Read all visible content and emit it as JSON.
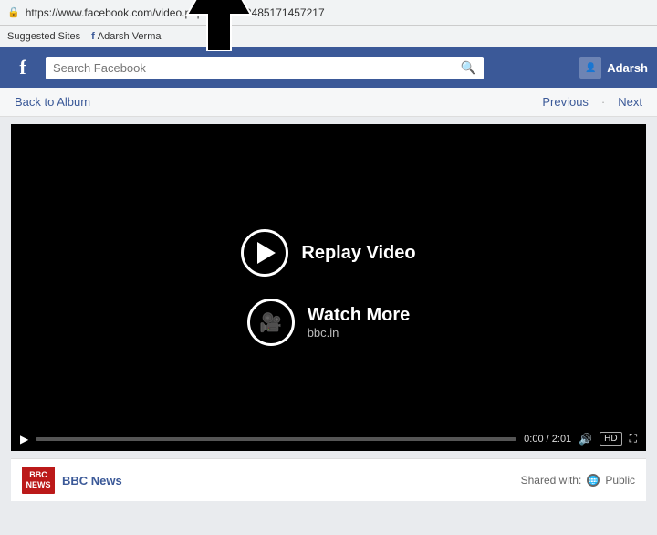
{
  "browser": {
    "url": "https://www.facebook.com/video.php?v=10152485171457217",
    "bookmarks": [
      {
        "label": "Suggested Sites"
      },
      {
        "label": "Adarsh Verma",
        "icon": "fb"
      }
    ]
  },
  "header": {
    "logo": "f",
    "search_placeholder": "Search Facebook",
    "user_name": "Adarsh"
  },
  "nav": {
    "back_label": "Back to Album",
    "previous_label": "Previous",
    "next_label": "Next"
  },
  "video": {
    "replay_label": "Replay Video",
    "watch_more_label": "Watch More",
    "watch_more_sub": "bbc.in",
    "time_current": "0:00",
    "time_total": "2:01",
    "hd_label": "HD"
  },
  "footer": {
    "channel_name": "BBC News",
    "bbc_top": "BBC",
    "bbc_bottom": "NEWS",
    "shared_label": "Shared with:",
    "audience_label": "Public"
  }
}
